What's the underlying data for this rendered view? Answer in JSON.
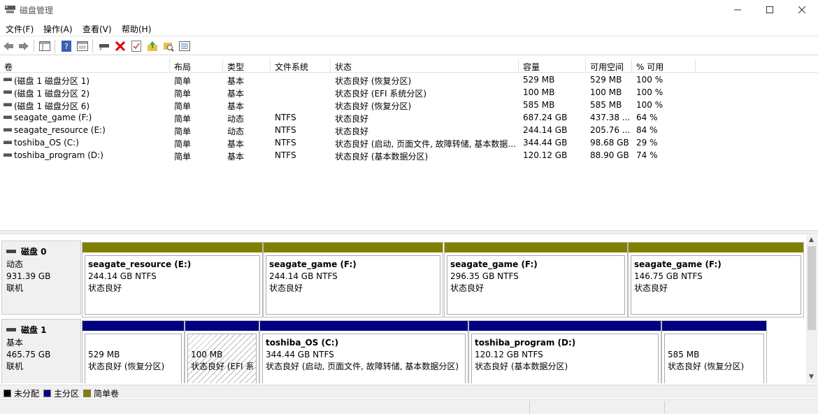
{
  "window": {
    "title": "磁盘管理"
  },
  "menu": [
    "文件(F)",
    "操作(A)",
    "查看(V)",
    "帮助(H)"
  ],
  "columns": [
    "卷",
    "布局",
    "类型",
    "文件系统",
    "状态",
    "容量",
    "可用空间",
    "% 可用"
  ],
  "volumes": [
    {
      "name": "(磁盘 1 磁盘分区 1)",
      "layout": "简单",
      "type": "基本",
      "fs": "",
      "status": "状态良好 (恢复分区)",
      "capacity": "529 MB",
      "free": "529 MB",
      "pct": "100 %"
    },
    {
      "name": "(磁盘 1 磁盘分区 2)",
      "layout": "简单",
      "type": "基本",
      "fs": "",
      "status": "状态良好 (EFI 系统分区)",
      "capacity": "100 MB",
      "free": "100 MB",
      "pct": "100 %"
    },
    {
      "name": "(磁盘 1 磁盘分区 6)",
      "layout": "简单",
      "type": "基本",
      "fs": "",
      "status": "状态良好 (恢复分区)",
      "capacity": "585 MB",
      "free": "585 MB",
      "pct": "100 %"
    },
    {
      "name": "seagate_game (F:)",
      "layout": "简单",
      "type": "动态",
      "fs": "NTFS",
      "status": "状态良好",
      "capacity": "687.24 GB",
      "free": "437.38 ...",
      "pct": "64 %"
    },
    {
      "name": "seagate_resource (E:)",
      "layout": "简单",
      "type": "动态",
      "fs": "NTFS",
      "status": "状态良好",
      "capacity": "244.14 GB",
      "free": "205.76 ...",
      "pct": "84 %"
    },
    {
      "name": "toshiba_OS (C:)",
      "layout": "简单",
      "type": "基本",
      "fs": "NTFS",
      "status": "状态良好 (启动, 页面文件, 故障转储, 基本数据...",
      "capacity": "344.44 GB",
      "free": "98.68 GB",
      "pct": "29 %"
    },
    {
      "name": "toshiba_program (D:)",
      "layout": "简单",
      "type": "基本",
      "fs": "NTFS",
      "status": "状态良好 (基本数据分区)",
      "capacity": "120.12 GB",
      "free": "88.90 GB",
      "pct": "74 %"
    }
  ],
  "disks": [
    {
      "name": "磁盘 0",
      "kind": "动态",
      "size": "931.39 GB",
      "state": "联机",
      "partitions": [
        {
          "title": "seagate_resource  (E:)",
          "size": "244.14 GB NTFS",
          "status": "状态良好",
          "color": "#808000"
        },
        {
          "title": "seagate_game  (F:)",
          "size": "244.14 GB NTFS",
          "status": "状态良好",
          "color": "#808000"
        },
        {
          "title": "seagate_game  (F:)",
          "size": "296.35 GB NTFS",
          "status": "状态良好",
          "color": "#808000"
        },
        {
          "title": "seagate_game  (F:)",
          "size": "146.75 GB NTFS",
          "status": "状态良好",
          "color": "#808000"
        }
      ]
    },
    {
      "name": "磁盘 1",
      "kind": "基本",
      "size": "465.75 GB",
      "state": "联机",
      "partitions": [
        {
          "title": "",
          "size": "529 MB",
          "status": "状态良好 (恢复分区)",
          "color": "#000080"
        },
        {
          "title": "",
          "size": "100 MB",
          "status": "状态良好 (EFI 系统",
          "color": "#000080"
        },
        {
          "title": "toshiba_OS  (C:)",
          "size": "344.44 GB NTFS",
          "status": "状态良好 (启动, 页面文件, 故障转储, 基本数据分区)",
          "color": "#000080"
        },
        {
          "title": "toshiba_program  (D:)",
          "size": "120.12 GB NTFS",
          "status": "状态良好 (基本数据分区)",
          "color": "#000080"
        },
        {
          "title": "",
          "size": "585 MB",
          "status": "状态良好 (恢复分区)",
          "color": "#000080"
        }
      ]
    }
  ],
  "legend": [
    {
      "label": "未分配",
      "color": "#000000"
    },
    {
      "label": "主分区",
      "color": "#000080"
    },
    {
      "label": "简单卷",
      "color": "#808000"
    }
  ]
}
